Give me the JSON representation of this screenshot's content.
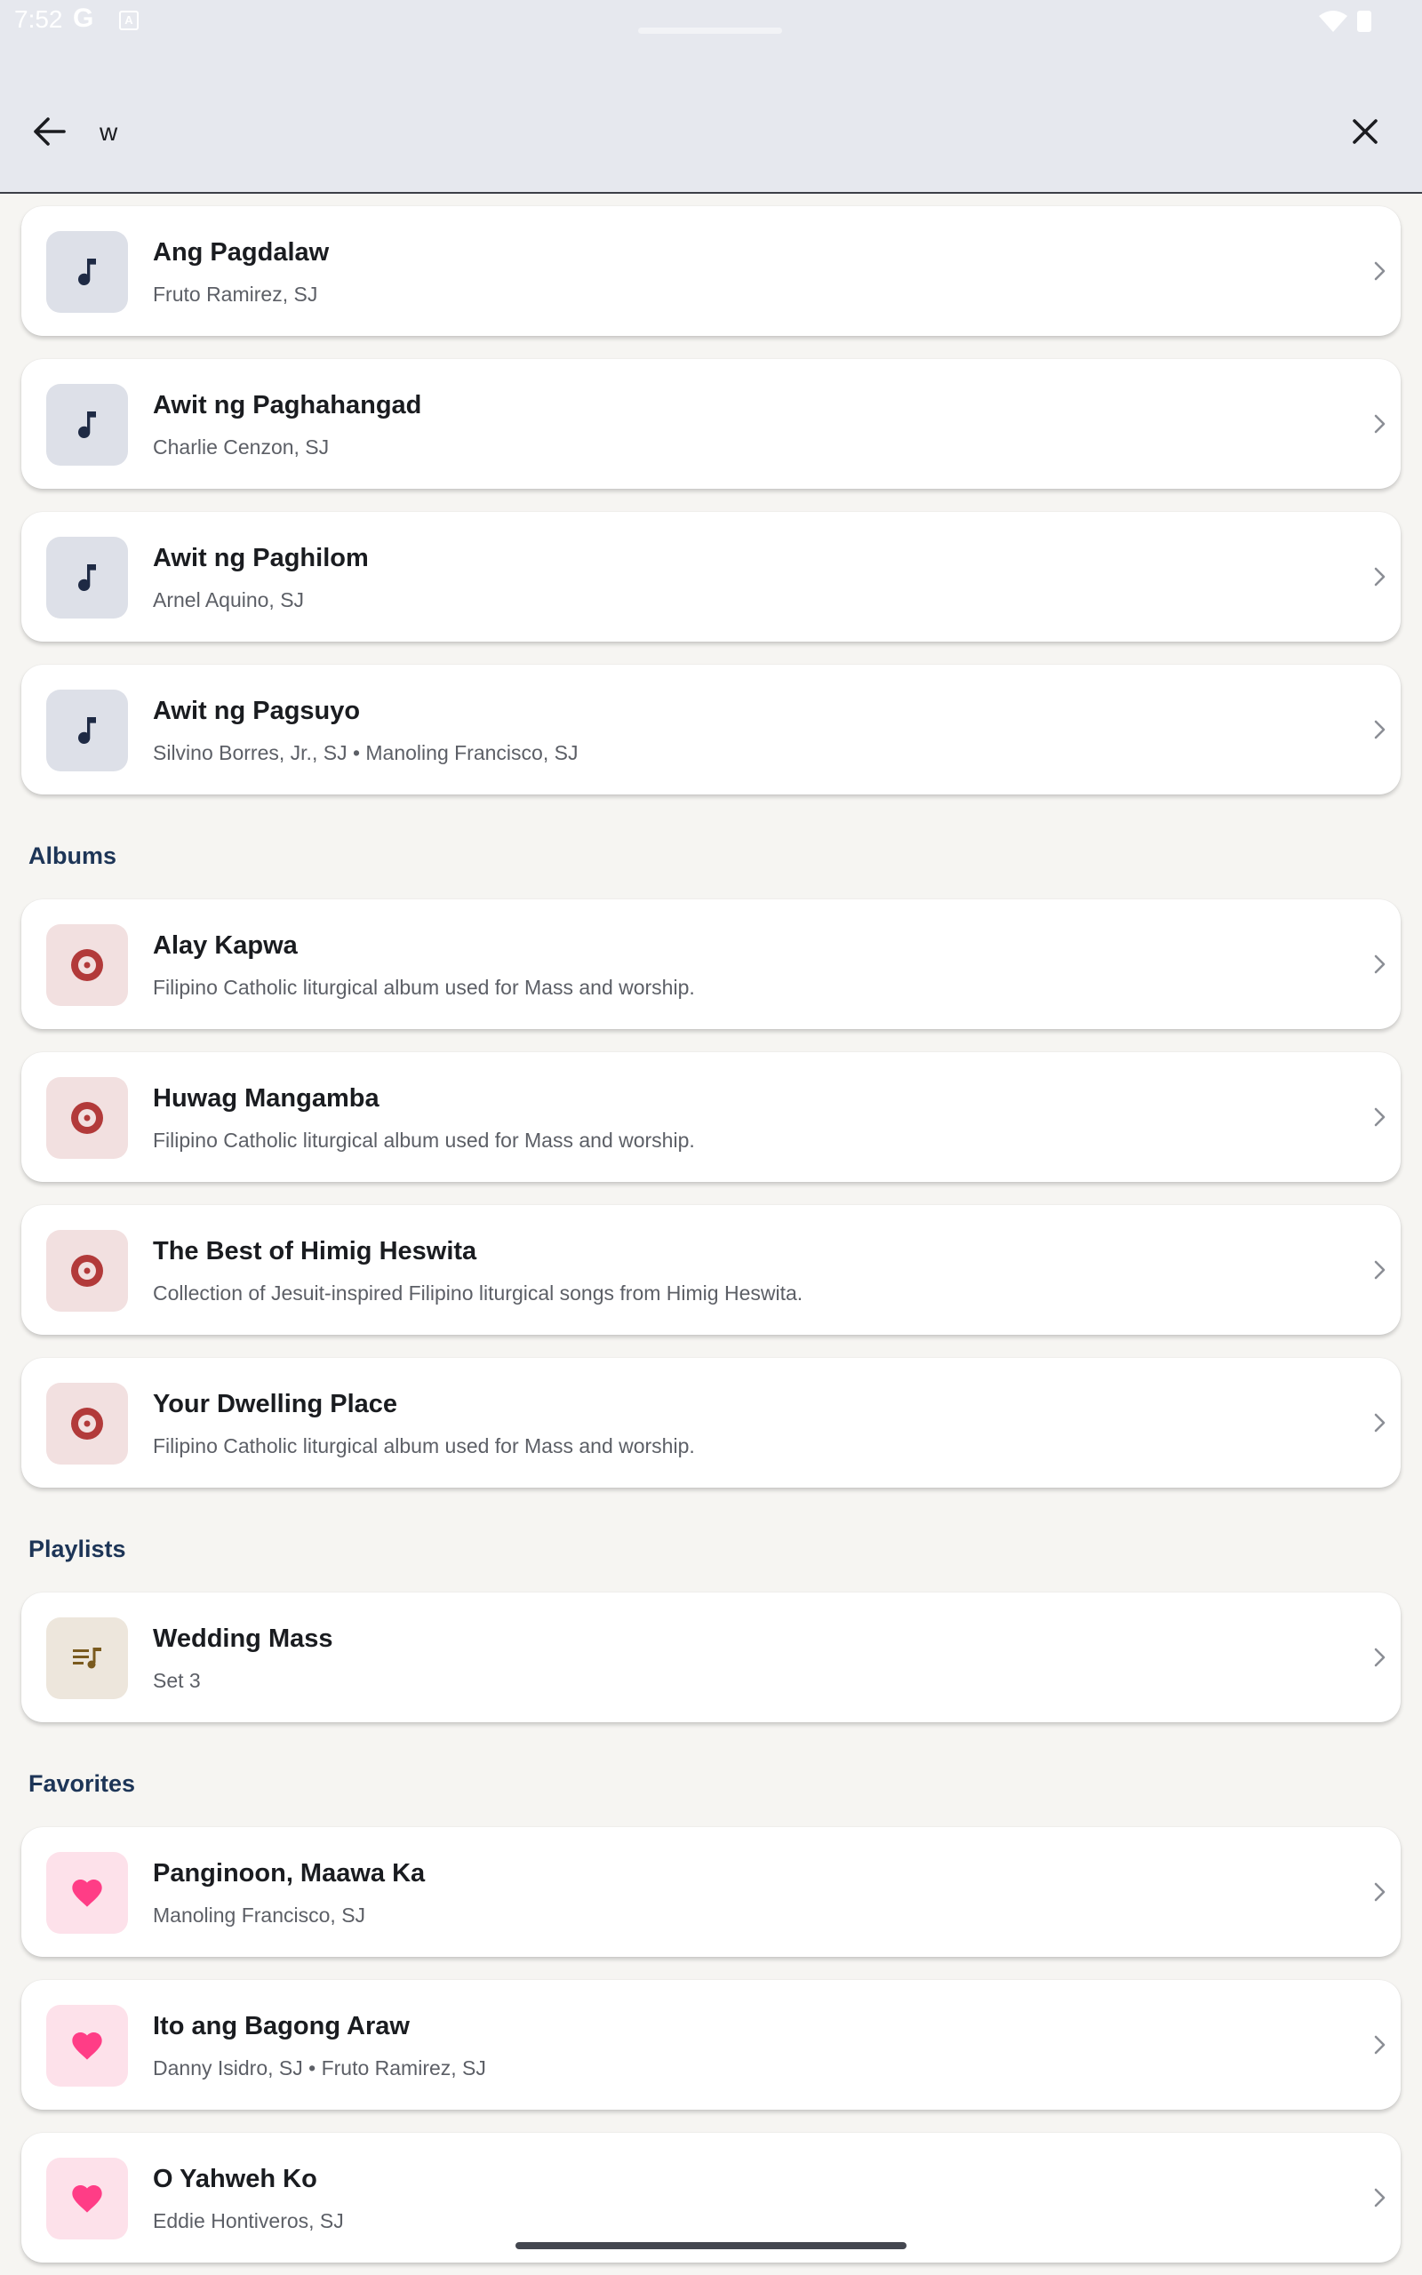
{
  "status_bar": {
    "time": "7:52",
    "g_label": "G",
    "a_label": "A"
  },
  "search": {
    "query": "w",
    "back_icon": "arrow-left-icon",
    "clear_icon": "close-icon"
  },
  "colors": {
    "section": "#1d3557",
    "song_icon": "#1e2a44",
    "album_icon": "#b23a3a",
    "playlist_icon": "#7a5a1e",
    "favorite_icon": "#ff3d86"
  },
  "songs": [
    {
      "title": "Ang Pagdalaw",
      "subtitle": "Fruto Ramirez, SJ",
      "icon": "music-note-icon"
    },
    {
      "title": "Awit ng Paghahangad",
      "subtitle": "Charlie Cenzon, SJ",
      "icon": "music-note-icon"
    },
    {
      "title": "Awit ng Paghilom",
      "subtitle": "Arnel Aquino, SJ",
      "icon": "music-note-icon"
    },
    {
      "title": "Awit ng Pagsuyo",
      "subtitle": "Silvino Borres, Jr., SJ • Manoling Francisco, SJ",
      "icon": "music-note-icon"
    }
  ],
  "albums": {
    "header": "Albums",
    "items": [
      {
        "title": "Alay Kapwa",
        "subtitle": "Filipino Catholic liturgical album used for Mass and worship.",
        "icon": "disc-icon"
      },
      {
        "title": "Huwag Mangamba",
        "subtitle": "Filipino Catholic liturgical album used for Mass and worship.",
        "icon": "disc-icon"
      },
      {
        "title": "The Best of Himig Heswita",
        "subtitle": "Collection of Jesuit-inspired Filipino liturgical songs from Himig Heswita.",
        "icon": "disc-icon"
      },
      {
        "title": "Your Dwelling Place",
        "subtitle": "Filipino Catholic liturgical album used for Mass and worship.",
        "icon": "disc-icon"
      }
    ]
  },
  "playlists": {
    "header": "Playlists",
    "items": [
      {
        "title": "Wedding Mass",
        "subtitle": "Set 3",
        "icon": "playlist-icon"
      }
    ]
  },
  "favorites": {
    "header": "Favorites",
    "items": [
      {
        "title": "Panginoon, Maawa Ka",
        "subtitle": "Manoling Francisco, SJ",
        "icon": "heart-icon"
      },
      {
        "title": "Ito ang Bagong Araw",
        "subtitle": "Danny Isidro, SJ • Fruto Ramirez, SJ",
        "icon": "heart-icon"
      },
      {
        "title": "O Yahweh Ko",
        "subtitle": "Eddie Hontiveros, SJ",
        "icon": "heart-icon"
      }
    ]
  }
}
